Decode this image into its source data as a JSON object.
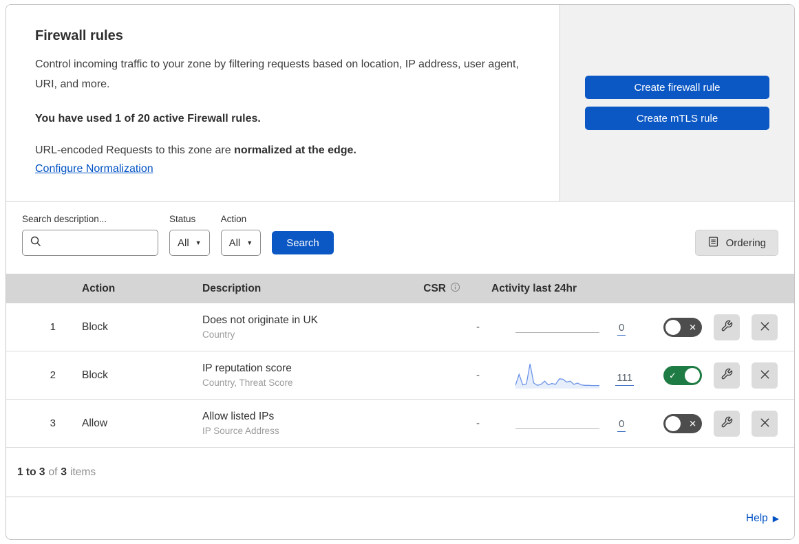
{
  "header": {
    "title": "Firewall rules",
    "description": "Control incoming traffic to your zone by filtering requests based on location, IP address, user agent, URI, and more.",
    "usage_bold": "You have used 1 of 20 active Firewall rules.",
    "normalization_prefix": "URL-encoded Requests to this zone are ",
    "normalization_bold": "normalized at the edge.",
    "normalization_link": "Configure Normalization",
    "create_firewall_label": "Create firewall rule",
    "create_mtls_label": "Create mTLS rule"
  },
  "filters": {
    "search_label": "Search description...",
    "search_value": "",
    "status_label": "Status",
    "status_value": "All",
    "action_label": "Action",
    "action_value": "All",
    "search_button": "Search",
    "ordering_button": "Ordering"
  },
  "table": {
    "columns": {
      "action": "Action",
      "description": "Description",
      "csr": "CSR",
      "activity": "Activity last 24hr"
    },
    "rows": [
      {
        "num": "1",
        "action": "Block",
        "description": "Does not originate in UK",
        "criteria": "Country",
        "csr": "-",
        "activity_count": "0",
        "enabled": false,
        "sparkline": false
      },
      {
        "num": "2",
        "action": "Block",
        "description": "IP reputation score",
        "criteria": "Country, Threat Score",
        "csr": "-",
        "activity_count": "111",
        "enabled": true,
        "sparkline": true
      },
      {
        "num": "3",
        "action": "Allow",
        "description": "Allow listed IPs",
        "criteria": "IP Source Address",
        "csr": "-",
        "activity_count": "0",
        "enabled": false,
        "sparkline": false
      }
    ]
  },
  "footer": {
    "range_bold": "1 to 3",
    "of_text": "of",
    "total_bold": "3",
    "items_text": "items"
  },
  "help": {
    "label": "Help"
  },
  "icons": {
    "caret_down": "▼",
    "check": "✓",
    "cross": "✕",
    "help_arrow": "▶"
  },
  "colors": {
    "primary_blue": "#0b57c4",
    "link_blue": "#0051c3",
    "toggle_on_green": "#1e7b44",
    "toggle_off_gray": "#4d4d4d",
    "table_header_gray": "#d5d5d5",
    "panel_gray": "#f1f1f1",
    "sparkline_blue": "#6b93e8",
    "sparkline_fill": "rgba(107,147,232,0.16)"
  },
  "chart_data": {
    "type": "line",
    "title": "Activity last 24hr sparkline (rule 2: IP reputation score)",
    "xlabel": "last 24 hours (unlabeled)",
    "ylabel": "requests (unlabeled)",
    "x": [
      1,
      2,
      3,
      4,
      5,
      6,
      7,
      8,
      9,
      10,
      11,
      12,
      13,
      14,
      15,
      16,
      17,
      18,
      19,
      20,
      21,
      22,
      23,
      24
    ],
    "values": [
      8,
      55,
      10,
      14,
      100,
      18,
      8,
      12,
      26,
      10,
      16,
      12,
      36,
      34,
      22,
      26,
      12,
      18,
      10,
      8,
      8,
      7,
      7,
      7
    ],
    "total_label": "111",
    "grid": false,
    "legend": false
  }
}
